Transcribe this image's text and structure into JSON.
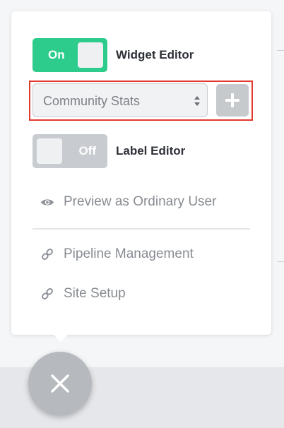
{
  "widget_editor": {
    "toggle_state": "On",
    "label": "Widget Editor",
    "enabled": true
  },
  "widget_select": {
    "selected": "Community Stats"
  },
  "label_editor": {
    "toggle_state": "Off",
    "label": "Label Editor",
    "enabled": false
  },
  "menu": {
    "preview": "Preview as Ordinary User",
    "pipeline": "Pipeline Management",
    "site_setup": "Site Setup"
  },
  "colors": {
    "toggle_on": "#2ecc8c",
    "toggle_off": "#c8cbcf",
    "highlight": "#e2392f",
    "fab": "#b6babe"
  },
  "icons": {
    "preview": "eye-icon",
    "pipeline": "link-icon",
    "site_setup": "link-icon",
    "add": "plus-icon",
    "close": "close-icon",
    "select": "select-caret-icon"
  }
}
